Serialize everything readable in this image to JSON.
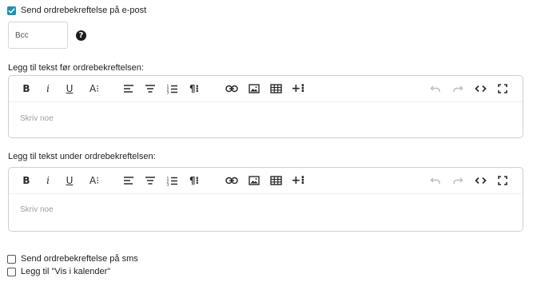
{
  "email": {
    "checkbox_label": "Send ordrebekreftelse på e-post",
    "checked": true
  },
  "bcc": {
    "placeholder": "Bcc",
    "value": "",
    "help_icon": "question-circle-icon",
    "help_symbol": "?"
  },
  "editors": [
    {
      "label": "Legg til tekst før ordrebekreftelsen:",
      "placeholder": "Skriv noe"
    },
    {
      "label": "Legg til tekst under ordrebekreftelsen:",
      "placeholder": "Skriv noe"
    }
  ],
  "toolbar": {
    "bold": "B",
    "italic": "i",
    "underline": "U",
    "font_size": "A⁝",
    "paragraph": "¶⁝",
    "insert_more": "+⁝",
    "icons": [
      "bold-icon",
      "italic-icon",
      "underline-icon",
      "font-size-icon",
      "align-left-icon",
      "align-center-icon",
      "ordered-list-icon",
      "paragraph-format-icon",
      "link-icon",
      "image-icon",
      "table-icon",
      "insert-more-icon",
      "undo-icon",
      "redo-icon",
      "code-view-icon",
      "fullscreen-icon"
    ]
  },
  "sms": {
    "checkbox_label": "Send ordrebekreftelse på sms",
    "checked": false
  },
  "calendar": {
    "checkbox_label": "Legg til \"Vis i kalender\"",
    "checked": false
  },
  "colors": {
    "accent": "#1f8fb8",
    "border": "#cfcfcf",
    "placeholder": "#9e9e9e"
  }
}
